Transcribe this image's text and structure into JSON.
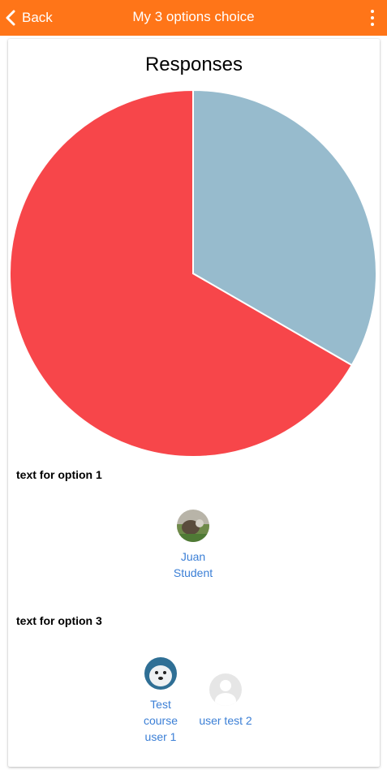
{
  "header": {
    "back_label": "Back",
    "title": "My 3 options choice",
    "background": "#ff7518"
  },
  "chart_data": {
    "type": "pie",
    "title": "Responses",
    "categories": [
      "text for option 1",
      "text for option 3"
    ],
    "values": [
      2,
      1
    ],
    "colors": [
      "#f7464a",
      "#97bbcd"
    ]
  },
  "options": [
    {
      "label": "text for option 1",
      "users": [
        {
          "name": "Juan Student",
          "avatar": "photo-avatar-icon"
        }
      ]
    },
    {
      "label": "text for option 3",
      "users": [
        {
          "name": "Test course user 1",
          "avatar": "dog-avatar-icon"
        },
        {
          "name": "user test 2",
          "avatar": "default-avatar-icon"
        }
      ]
    }
  ],
  "colors": {
    "link": "#3b7fd6"
  }
}
